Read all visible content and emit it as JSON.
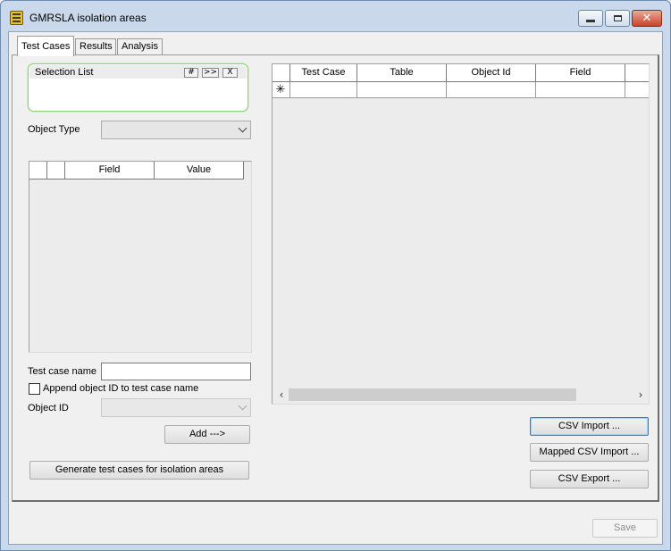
{
  "window": {
    "title": "GMRSLA isolation areas",
    "app_icon": "database-icon",
    "controls": [
      "minimize-icon",
      "maximize-icon",
      "close-icon"
    ],
    "close_glyph": "✕"
  },
  "tabs": [
    {
      "label": "Test Cases",
      "active": true
    },
    {
      "label": "Results",
      "active": false
    },
    {
      "label": "Analysis",
      "active": false
    }
  ],
  "selection_list": {
    "label": "Selection List",
    "buttons": [
      "#",
      ">>",
      "X"
    ]
  },
  "object_type": {
    "label": "Object Type",
    "value": ""
  },
  "field_grid": {
    "columns": [
      "",
      "",
      "Field",
      "Value"
    ]
  },
  "test_case_name": {
    "label": "Test case name",
    "value": ""
  },
  "append_checkbox": {
    "label": "Append object ID to test case name",
    "checked": false
  },
  "object_id": {
    "label": "Object ID",
    "value": ""
  },
  "buttons": {
    "add": "Add --->",
    "generate": "Generate test cases for isolation areas",
    "csv_import": "CSV Import ...",
    "mapped_csv_import": "Mapped CSV Import ...",
    "csv_export": "CSV Export ...",
    "save": "Save"
  },
  "test_case_grid": {
    "columns": [
      "",
      "Test Case",
      "Table",
      "Object Id",
      "Field",
      ""
    ],
    "new_row_glyph": "✳",
    "scroll_left": "‹",
    "scroll_right": "›"
  }
}
